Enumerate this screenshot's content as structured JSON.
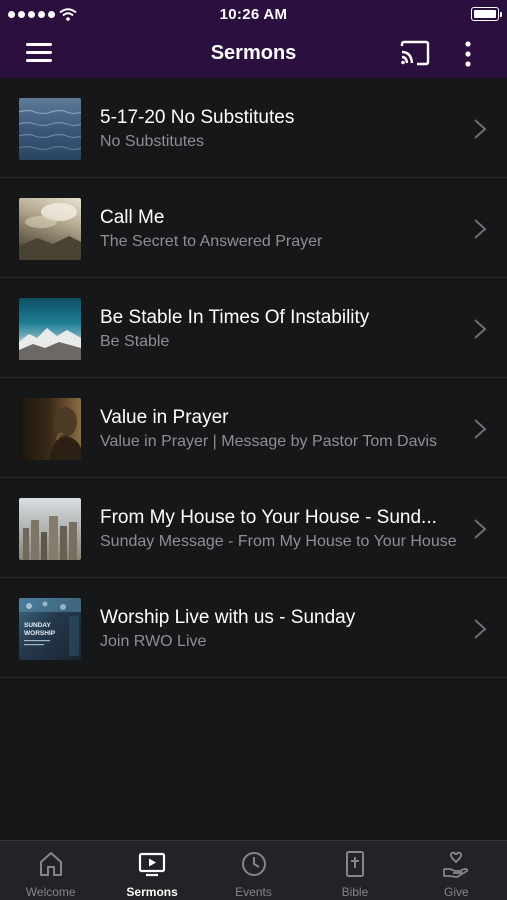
{
  "status_bar": {
    "time": "10:26 AM"
  },
  "navbar": {
    "title": "Sermons"
  },
  "sermons": [
    {
      "title": "5-17-20 No Substitutes",
      "subtitle": "No Substitutes"
    },
    {
      "title": "Call Me",
      "subtitle": "The Secret to Answered Prayer"
    },
    {
      "title": "Be Stable In Times Of Instability",
      "subtitle": "Be Stable"
    },
    {
      "title": "Value in Prayer",
      "subtitle": "Value in Prayer | Message by Pastor Tom Davis"
    },
    {
      "title": "From My House to Your House - Sund...",
      "subtitle": "Sunday Message - From My House to Your House"
    },
    {
      "title": "Worship Live with us - Sunday",
      "subtitle": "Join RWO Live",
      "thumb_text": "SUNDAY WORSHIP"
    }
  ],
  "tabs": [
    {
      "label": "Welcome",
      "icon": "home-icon"
    },
    {
      "label": "Sermons",
      "icon": "tv-play-icon",
      "active": true
    },
    {
      "label": "Events",
      "icon": "clock-icon"
    },
    {
      "label": "Bible",
      "icon": "bible-icon"
    },
    {
      "label": "Give",
      "icon": "give-icon"
    }
  ],
  "colors": {
    "header": "#2a0f3f",
    "background": "#161719",
    "tabbar": "#222326",
    "subtitle": "#8e8f93"
  }
}
